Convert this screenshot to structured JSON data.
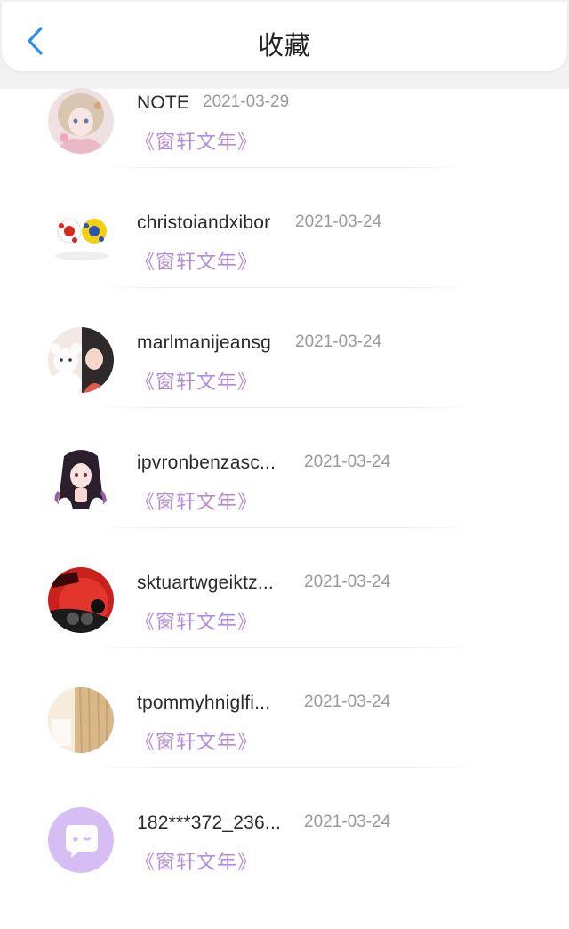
{
  "header": {
    "title": "收藏"
  },
  "items": [
    {
      "name": "NOTE",
      "date": "2021-03-29",
      "book": "《窗轩文年》",
      "avatar": "anime-girl-pink-avatar"
    },
    {
      "name": "christoiandxibor",
      "date": "2021-03-24",
      "book": "《窗轩文年》",
      "avatar": "soccer-balls-avatar"
    },
    {
      "name": "marlmanijeansg",
      "date": "2021-03-24",
      "book": "《窗轩文年》",
      "avatar": "bear-and-girl-avatar"
    },
    {
      "name": "ipvronbenzasc...",
      "date": "2021-03-24",
      "book": "《窗轩文年》",
      "avatar": "anime-girl-dark-hair-avatar"
    },
    {
      "name": "sktuartwgeiktz...",
      "date": "2021-03-24",
      "book": "《窗轩文年》",
      "avatar": "dance-red-avatar"
    },
    {
      "name": "tpommyhniglfi...",
      "date": "2021-03-24",
      "book": "《窗轩文年》",
      "avatar": "curtain-window-avatar"
    },
    {
      "name": "182***372_236...",
      "date": "2021-03-24",
      "book": "《窗轩文年》",
      "avatar": "default-chat-avatar"
    }
  ]
}
